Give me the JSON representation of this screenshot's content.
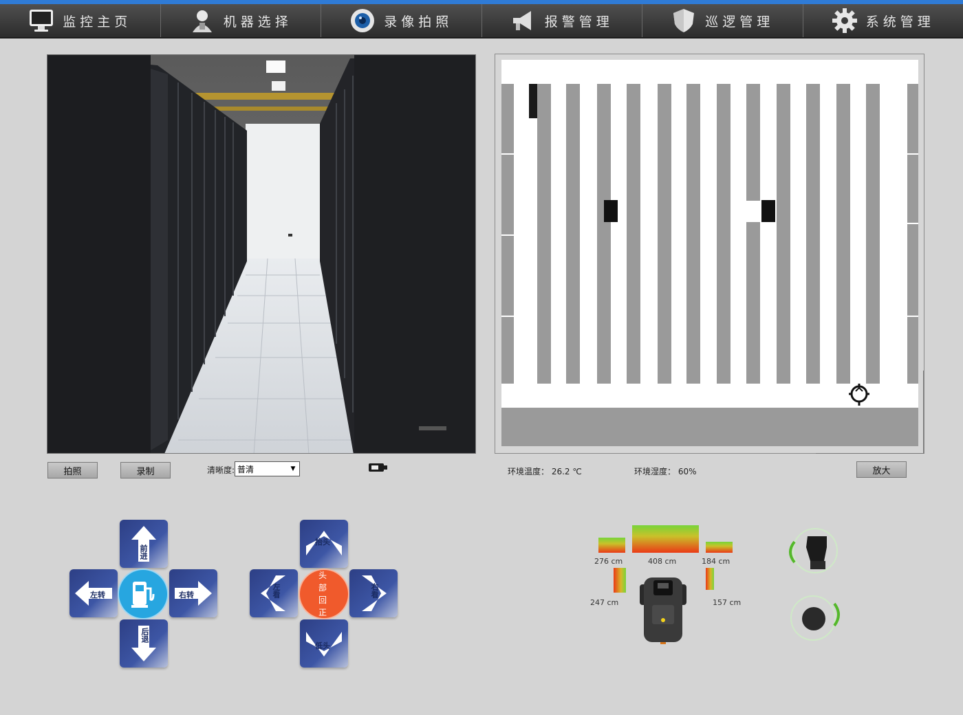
{
  "nav": {
    "items": [
      {
        "label": "监控主页",
        "icon": "monitor-icon"
      },
      {
        "label": "机器选择",
        "icon": "robot-user-icon"
      },
      {
        "label": "录像拍照",
        "icon": "camera-lens-icon"
      },
      {
        "label": "报警管理",
        "icon": "alarm-horn-icon"
      },
      {
        "label": "巡逻管理",
        "icon": "shield-icon"
      },
      {
        "label": "系统管理",
        "icon": "gear-icon"
      }
    ]
  },
  "video_controls": {
    "snapshot_label": "拍照",
    "record_label": "录制",
    "clarity_label": "清晰度:",
    "clarity_value": "普清",
    "charge_icon": "charging-plug-icon"
  },
  "env": {
    "temperature": "环境温度： 26.2 ℃",
    "humidity": "环境湿度： 60%",
    "zoom_label": "放大"
  },
  "move_pad": {
    "forward": "前进",
    "back": "后退",
    "left": "左转",
    "right": "右转",
    "center_icon": "charging-station-icon"
  },
  "head_pad": {
    "up": "抬头",
    "down": "低头",
    "left": "左看",
    "right": "右看",
    "center": "头部回正"
  },
  "sensors": {
    "front_left": "276 cm",
    "front": "408 cm",
    "front_right": "184 cm",
    "left": "247 cm",
    "right": "157 cm",
    "front_left_level": 0.55,
    "front_level": 1.0,
    "front_right_level": 0.4,
    "left_level": 0.9,
    "right_level": 0.8
  }
}
